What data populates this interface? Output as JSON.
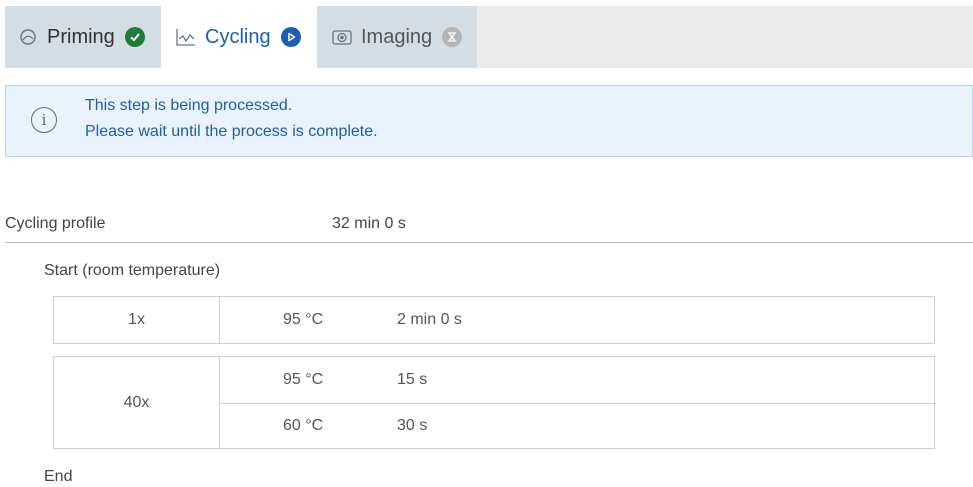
{
  "tabs": [
    {
      "label": "Priming",
      "status": "completed",
      "status_color": "#1e7b3c"
    },
    {
      "label": "Cycling",
      "status": "running",
      "status_color": "#1a5fb4"
    },
    {
      "label": "Imaging",
      "status": "pending",
      "status_color": "#b5b5b5"
    }
  ],
  "banner": {
    "line1": "This step is being processed.",
    "line2": "Please wait until the process is complete.",
    "icon": "info-icon"
  },
  "profile": {
    "label": "Cycling profile",
    "duration": "32 min 0 s",
    "start_label": "Start (room temperature)",
    "end_label": "End",
    "steps": [
      {
        "count": "1x",
        "rows": [
          {
            "temp": "95 °C",
            "time": "2 min 0 s"
          }
        ]
      },
      {
        "count": "40x",
        "rows": [
          {
            "temp": "95 °C",
            "time": "15 s"
          },
          {
            "temp": "60 °C",
            "time": "30 s"
          }
        ]
      }
    ]
  },
  "colors": {
    "accent": "#1a5fb4",
    "tab_inactive_bg": "#d3dde3",
    "banner_bg": "#eaf2fb",
    "success": "#1e7b3c"
  }
}
